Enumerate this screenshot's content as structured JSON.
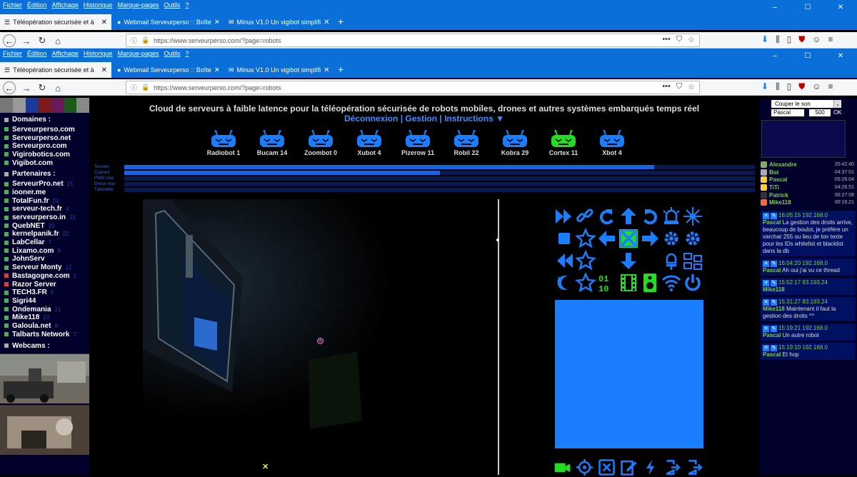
{
  "menu": {
    "items": [
      "Fichier",
      "Édition",
      "Affichage",
      "Historique",
      "Marque-pages",
      "Outils",
      "?"
    ],
    "window_controls": [
      "–",
      "☐",
      "✕"
    ]
  },
  "tabs": [
    {
      "label": "Téléopération sécurisée et à",
      "active": true
    },
    {
      "label": "Webmail Serveurperso :: Boîte",
      "active": false
    },
    {
      "label": "Minus V1.0 Un vigibot simplifi",
      "active": false
    }
  ],
  "url": "https://www.serveurperso.com/?page=robots",
  "url_actions": [
    "•••",
    "⛉",
    "☆"
  ],
  "sidebar": {
    "sections": {
      "domaines": "Domaines :",
      "partenaires": "Partenaires :",
      "webcams": "Webcams :"
    },
    "domaines": [
      "Serveurperso.com",
      "Serveurperso.net",
      "Serveurpro.com",
      "Vigirobotics.com",
      "Vigibot.com"
    ],
    "partenaires": [
      {
        "name": "ServeurPro.net",
        "count": "21",
        "color": "#4caf50"
      },
      {
        "name": "iooner.me",
        "count": "",
        "color": "#4caf50"
      },
      {
        "name": "TotalFun.fr",
        "count": "24",
        "color": "#4caf50"
      },
      {
        "name": "serveur-tech.fr",
        "count": "4",
        "color": "#4caf50"
      },
      {
        "name": "serveurperso.in",
        "count": "15",
        "color": "#4caf50"
      },
      {
        "name": "QuebNET",
        "count": "20",
        "color": "#4caf50"
      },
      {
        "name": "kernelpanik.fr",
        "count": "22",
        "color": "#4caf50"
      },
      {
        "name": "LabCellar",
        "count": "7",
        "color": "#4caf50"
      },
      {
        "name": "Lixamo.com",
        "count": "9",
        "color": "#4caf50"
      },
      {
        "name": "JohnServ",
        "count": "",
        "color": "#4caf50"
      },
      {
        "name": "Serveur Monty",
        "count": "12",
        "color": "#4caf50"
      },
      {
        "name": "Bastagogne.com",
        "count": "1",
        "color": "#e53935"
      },
      {
        "name": "Razor Server",
        "count": "",
        "color": "#e53935"
      },
      {
        "name": "TECH3.FR",
        "count": "6",
        "color": "#4caf50"
      },
      {
        "name": "Sigri44",
        "count": "",
        "color": "#4caf50"
      },
      {
        "name": "Ondemania",
        "count": "21",
        "color": "#4caf50"
      },
      {
        "name": "Mike118",
        "count": "22",
        "color": "#4caf50"
      },
      {
        "name": "Galoula.net",
        "count": "8",
        "color": "#4caf50"
      },
      {
        "name": "Talbarts Network",
        "count": "7",
        "color": "#4caf50"
      }
    ]
  },
  "main": {
    "headline": "Cloud de serveurs à faible latence pour la téléopération sécurisée de robots mobiles, drones et autres systèmes embarqués temps réel",
    "links": [
      "Déconnexion",
      "Gestion",
      "Instructions ▼"
    ],
    "robots": [
      {
        "name": "Radiobot 1",
        "color": "#1a7fff"
      },
      {
        "name": "Bucam 14",
        "color": "#1a7fff"
      },
      {
        "name": "Zoombot 0",
        "color": "#1a7fff"
      },
      {
        "name": "Xubot 4",
        "color": "#1a7fff"
      },
      {
        "name": "Pizerow 11",
        "color": "#1a7fff"
      },
      {
        "name": "Robil 22",
        "color": "#1a7fff"
      },
      {
        "name": "Kobra 29",
        "color": "#1a7fff"
      },
      {
        "name": "Cortex 11",
        "color": "#22dd22"
      },
      {
        "name": "Xbot 4",
        "color": "#1a7fff"
      }
    ],
    "gauges": [
      {
        "label": "Tension",
        "level": 0.84
      },
      {
        "label": "Courant",
        "level": 0.5
      },
      {
        "label": "PWM max",
        "level": 0
      },
      {
        "label": "Erreur max",
        "level": 0
      },
      {
        "label": "Télémètre",
        "level": 0
      }
    ],
    "controls": [
      "fast-forward",
      "link",
      "rotate-left",
      "arrow-up",
      "rotate-right",
      "alarm",
      "lamp",
      "stop",
      "star",
      "arrow-left",
      "center-x",
      "arrow-right",
      "gear",
      "gear-alt",
      "rewind",
      "star-2",
      "blank",
      "arrow-down",
      "blank",
      "bulb",
      "network",
      "moon-sleep",
      "star-3",
      "binary",
      "film",
      "speaker",
      "wifi",
      "power"
    ],
    "bottom_controls": [
      "camera",
      "target",
      "x-box",
      "edit",
      "bolt",
      "exit",
      "logout"
    ]
  },
  "chat": {
    "select_value": "Couper le son",
    "pseudo": "Pascal",
    "value": "500",
    "ok": "OK",
    "users": [
      {
        "name": "Alexandre",
        "time": "20:42:40",
        "color": "#8a6"
      },
      {
        "name": "Bot",
        "time": "04:37:01",
        "color": "#aaa"
      },
      {
        "name": "Pascal",
        "time": "05:26:04",
        "color": "#fc3"
      },
      {
        "name": "TiTi",
        "time": "04:26:51",
        "color": "#fc3"
      },
      {
        "name": "Patrick",
        "time": "00:27:08",
        "color": "#333"
      },
      {
        "name": "Mike118",
        "time": "00:16:21",
        "color": "#f63"
      }
    ],
    "messages": [
      {
        "meta": "16:05:15 192.168.0",
        "who": "Pascal",
        "text": "La gestion des droits arrive, beaucoup de boulot, je préfère un varchar 255 ou lieu de ton texte pour les IDs whitelist et blacklist dans la db"
      },
      {
        "meta": "16:04:20 192.168.0",
        "who": "Pascal",
        "text": "Ah oui j'ai vu ce thread"
      },
      {
        "meta": "15:52:17 83.193.24",
        "who": "Mike118",
        "text": ""
      },
      {
        "meta": "15:31:27 83.193.24",
        "who": "Mike118",
        "text": "Maintenant il faut la gestion des droits ^^"
      },
      {
        "meta": "15:19:21 192.168.0",
        "who": "Pascal",
        "text": "Un autre robot"
      },
      {
        "meta": "15:19:10 192.168.0",
        "who": "Pascal",
        "text": "Et hop"
      }
    ]
  },
  "colors": {
    "accent": "#1a7fff",
    "browser": "#0a6fd8",
    "link": "#3d8fff",
    "active_robot": "#22dd22"
  }
}
